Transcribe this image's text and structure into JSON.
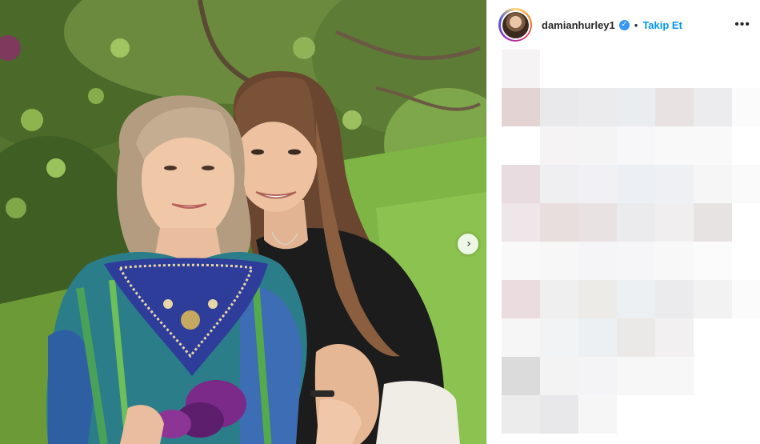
{
  "post": {
    "username": "damianhurley1",
    "verified_icon": "verified-badge-icon",
    "separator": "•",
    "follow_label": "Takip Et",
    "more_label": "•••",
    "next_icon": "›"
  },
  "colors": {
    "follow_blue": "#0095f6",
    "verified_blue": "#3897f0",
    "text": "#262626"
  },
  "comments_mosaic": {
    "description_icon": "pixelated-blur",
    "rows": [
      [
        "#f6f3f5",
        "#ffffff",
        "#ffffff",
        "#ffffff",
        "#ffffff",
        "#ffffff",
        "#ffffff"
      ],
      [
        "#e3d3d3",
        "#e9e9ec",
        "#ebebee",
        "#eaedf0",
        "#e8e2e2",
        "#ececef",
        "#fbfbfb"
      ],
      [
        "#ffffff",
        "#f5f3f3",
        "#f4f4f4",
        "#f7f7f9",
        "#f9f9f9",
        "#f9f9fa",
        "#ffffff"
      ],
      [
        "#e8dce0",
        "#efeff2",
        "#f1f1f5",
        "#eceff3",
        "#eef0f3",
        "#f6f6f7",
        "#fafafa"
      ],
      [
        "#efe6ea",
        "#e9dede",
        "#e9e2e2",
        "#ebebee",
        "#f0eeee",
        "#e8e3e3",
        "#ffffff"
      ],
      [
        "#f9f9f9",
        "#f7f7f7",
        "#f5f5f7",
        "#f6f6f8",
        "#f8f8f8",
        "#fbfbfb",
        "#ffffff"
      ],
      [
        "#eadcdf",
        "#efefef",
        "#ecebe8",
        "#edf0f3",
        "#ebebee",
        "#f2f2f2",
        "#fbfbfb"
      ],
      [
        "#f6f6f6",
        "#f1f3f5",
        "#ecf0f3",
        "#ebe9e8",
        "#f2f0f0",
        "#ffffff",
        "#ffffff"
      ],
      [
        "#dcdbdc",
        "#f3f3f3",
        "#f4f4f6",
        "#f7f7f7",
        "#f7f7f7",
        "#ffffff",
        "#ffffff"
      ],
      [
        "#ececec",
        "#e8e8ea",
        "#f6f6f6",
        "#ffffff",
        "#ffffff",
        "#ffffff",
        "#ffffff"
      ]
    ]
  }
}
